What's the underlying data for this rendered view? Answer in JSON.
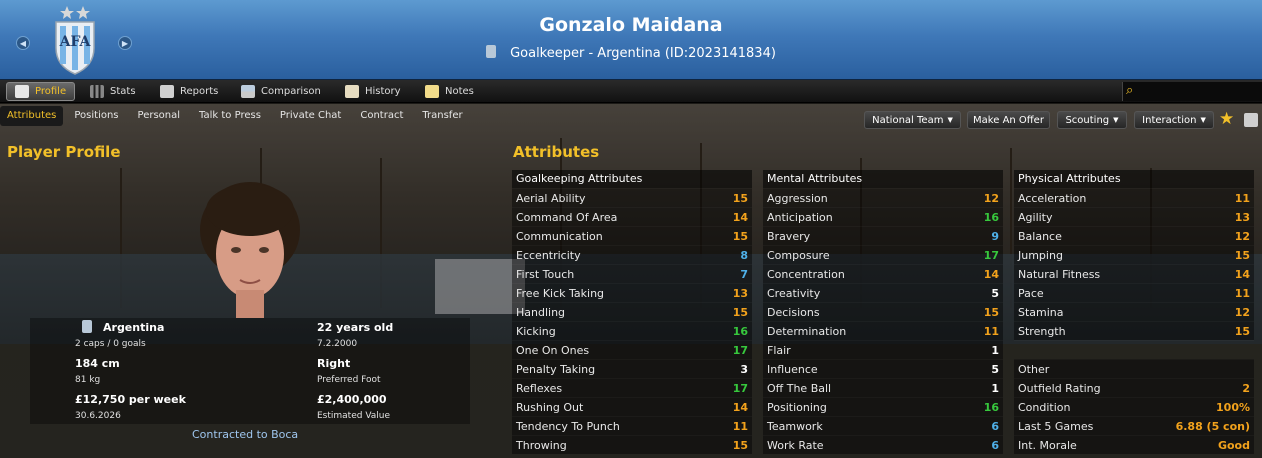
{
  "header": {
    "player_name": "Gonzalo Maidana",
    "subtitle": "Goalkeeper - Argentina (ID:2023141834)"
  },
  "icons": {
    "prev": "left-arrow-icon",
    "next": "right-arrow-icon",
    "search": "search-icon",
    "star": "star-icon",
    "notes": "notes-icon"
  },
  "tabs_main": [
    "Profile",
    "Stats",
    "Reports",
    "Comparison",
    "History",
    "Notes"
  ],
  "tabs_sub": [
    "Attributes",
    "Positions",
    "Personal",
    "Talk to Press",
    "Private Chat",
    "Contract",
    "Transfer"
  ],
  "actions": {
    "national_team": "National Team",
    "make_offer": "Make An Offer",
    "scouting": "Scouting",
    "interaction": "Interaction"
  },
  "profile": {
    "title": "Player Profile",
    "nation": "Argentina",
    "caps": "2 caps / 0 goals",
    "age": "22 years old",
    "dob": "7.2.2000",
    "height": "184 cm",
    "weight": "81 kg",
    "foot": "Right",
    "foot_label": "Preferred Foot",
    "wage": "£12,750 per week",
    "contract_end": "30.6.2026",
    "value": "£2,400,000",
    "value_label": "Estimated Value",
    "contracted": "Contracted to Boca"
  },
  "attributes_title": "Attributes",
  "goalkeeping": {
    "title": "Goalkeeping Attributes",
    "rows": [
      [
        "Aerial Ability",
        "15"
      ],
      [
        "Command Of Area",
        "14"
      ],
      [
        "Communication",
        "15"
      ],
      [
        "Eccentricity",
        "8"
      ],
      [
        "First Touch",
        "7"
      ],
      [
        "Free Kick Taking",
        "13"
      ],
      [
        "Handling",
        "15"
      ],
      [
        "Kicking",
        "16"
      ],
      [
        "One On Ones",
        "17"
      ],
      [
        "Penalty Taking",
        "3"
      ],
      [
        "Reflexes",
        "17"
      ],
      [
        "Rushing Out",
        "14"
      ],
      [
        "Tendency To Punch",
        "11"
      ],
      [
        "Throwing",
        "15"
      ]
    ]
  },
  "mental": {
    "title": "Mental Attributes",
    "rows": [
      [
        "Aggression",
        "12"
      ],
      [
        "Anticipation",
        "16"
      ],
      [
        "Bravery",
        "9"
      ],
      [
        "Composure",
        "17"
      ],
      [
        "Concentration",
        "14"
      ],
      [
        "Creativity",
        "5"
      ],
      [
        "Decisions",
        "15"
      ],
      [
        "Determination",
        "11"
      ],
      [
        "Flair",
        "1"
      ],
      [
        "Influence",
        "5"
      ],
      [
        "Off The Ball",
        "1"
      ],
      [
        "Positioning",
        "16"
      ],
      [
        "Teamwork",
        "6"
      ],
      [
        "Work Rate",
        "6"
      ]
    ]
  },
  "physical": {
    "title": "Physical Attributes",
    "rows": [
      [
        "Acceleration",
        "11"
      ],
      [
        "Agility",
        "13"
      ],
      [
        "Balance",
        "12"
      ],
      [
        "Jumping",
        "15"
      ],
      [
        "Natural Fitness",
        "14"
      ],
      [
        "Pace",
        "11"
      ],
      [
        "Stamina",
        "12"
      ],
      [
        "Strength",
        "15"
      ]
    ]
  },
  "other": {
    "title": "Other",
    "rows": [
      [
        "Outfield Rating",
        "2"
      ],
      [
        "Condition",
        "100%"
      ],
      [
        "Last 5 Games",
        "6.88 (5 con)"
      ],
      [
        "Int. Morale",
        "Good"
      ]
    ]
  }
}
